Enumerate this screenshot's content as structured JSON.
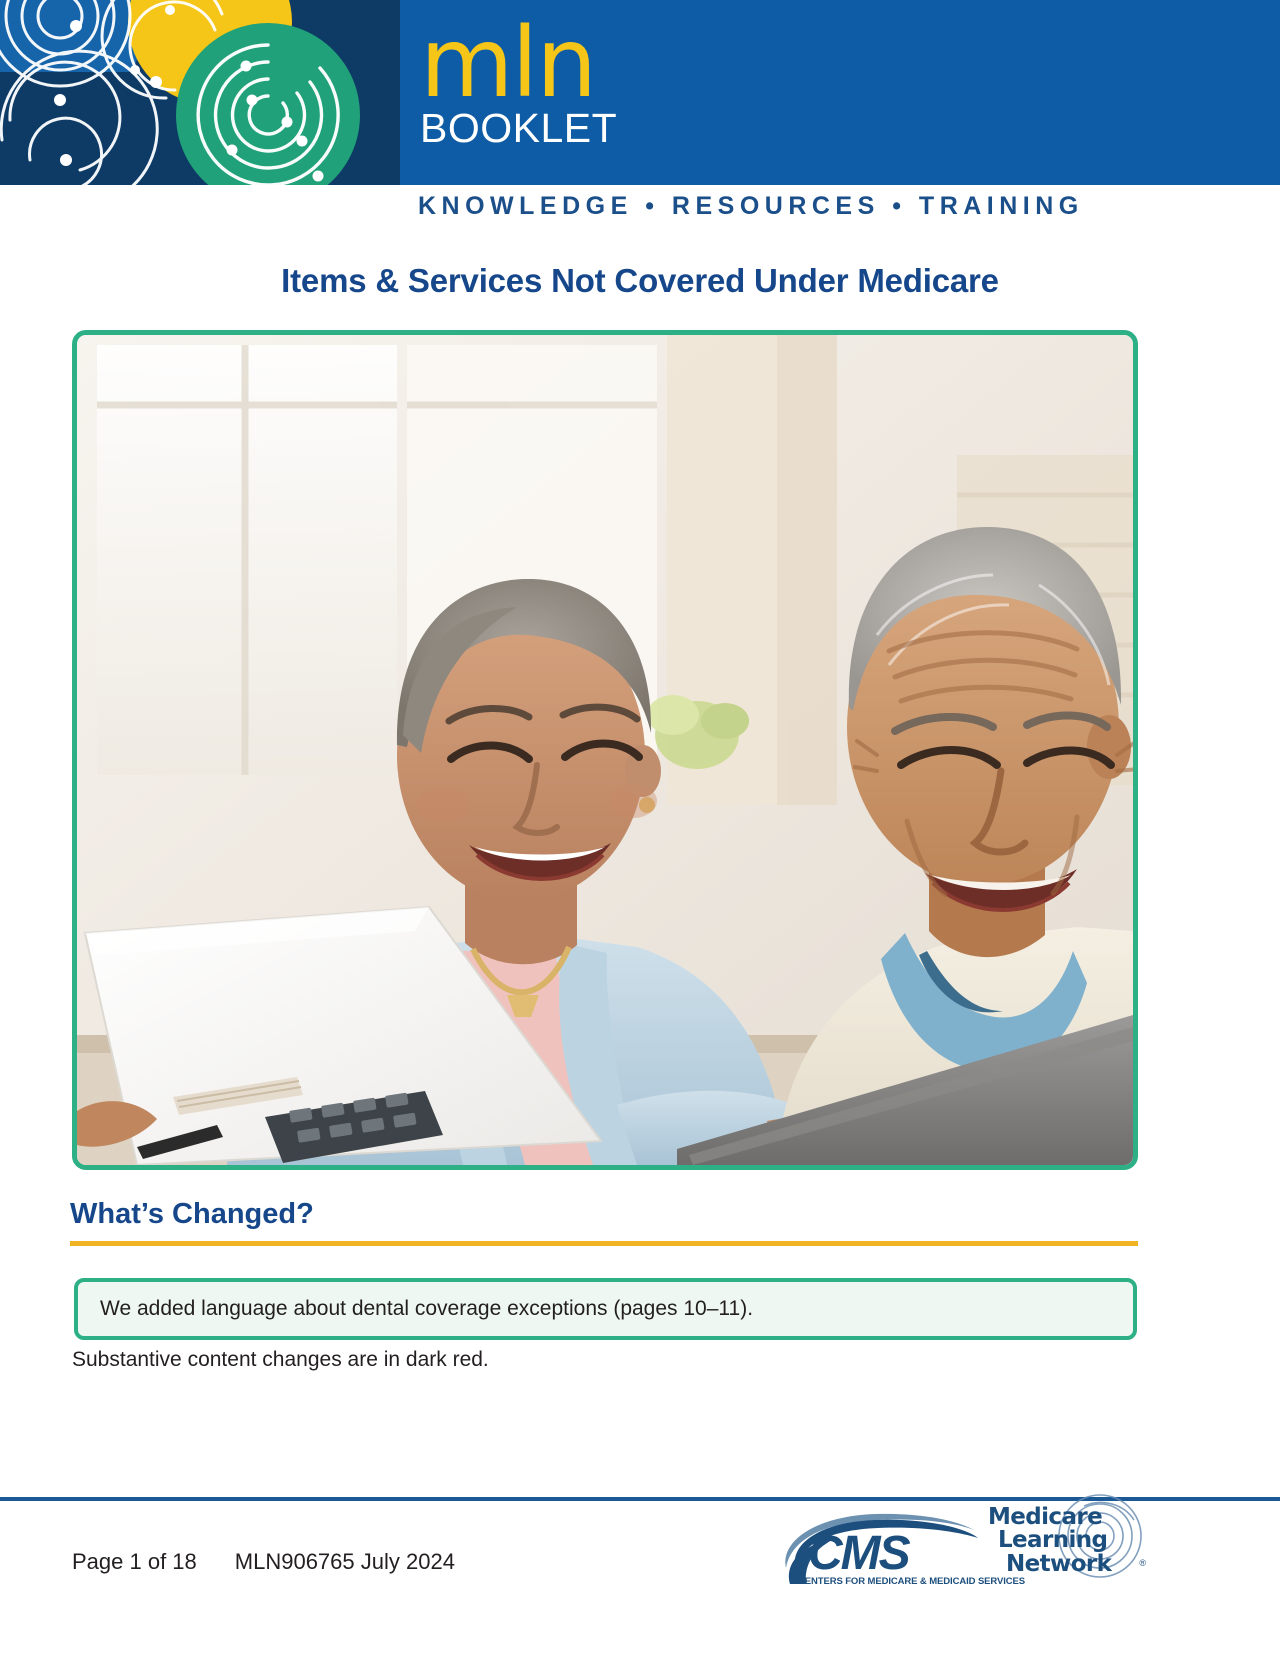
{
  "banner": {
    "logo_primary": "mln",
    "logo_secondary": "BOOKLET",
    "tagline": "KNOWLEDGE  •  RESOURCES  •  TRAINING",
    "background_color": "#0d5ca5",
    "logo_primary_color": "#f5c518",
    "logo_secondary_color": "#ffffff",
    "tagline_color": "#1b4f8a"
  },
  "title": "Items & Services Not Covered Under Medicare",
  "hero": {
    "alt": "Smiling older couple reviewing a document together at a table with a laptop and calculator",
    "border_color": "#2eb086"
  },
  "section": {
    "heading": "What’s Changed?",
    "rule_color": "#f0b323",
    "callout": "We added language about dental coverage exceptions (pages 10–11).",
    "callout_border_color": "#2eb086",
    "note": "Substantive content changes are in dark red."
  },
  "footer": {
    "page_label": "Page 1 of 18",
    "doc_id": "MLN906765 July 2024",
    "rule_color": "#1b5896",
    "cms_logo": {
      "wordmark": "CMS",
      "subtitle": "CENTERS FOR MEDICARE & MEDICAID SERVICES",
      "color": "#1d4f7e"
    },
    "mln_logo": {
      "line1": "Medicare",
      "line2": "Learning",
      "line3": "Network",
      "registered": "®",
      "color": "#1d4f7e"
    }
  }
}
